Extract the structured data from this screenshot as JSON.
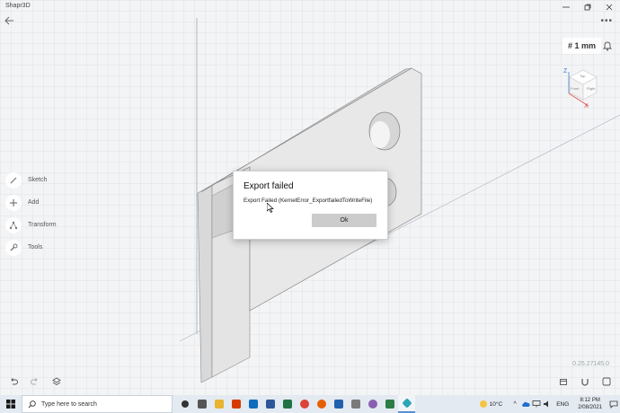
{
  "window": {
    "title": "Shapr3D",
    "controls": [
      "minimize-icon",
      "maximize-icon",
      "close-icon"
    ]
  },
  "toolbar": {
    "more_label": "•••",
    "grid_hash": "#",
    "grid_value": "1 mm"
  },
  "view_cube": {
    "axis_z": "Z",
    "axis_x": "X",
    "face_top": "Top",
    "face_front": "Front",
    "face_right": "Right"
  },
  "tools": [
    {
      "label": "Sketch",
      "icon": "pencil-icon"
    },
    {
      "label": "Add",
      "icon": "plus-icon"
    },
    {
      "label": "Transform",
      "icon": "transform-icon"
    },
    {
      "label": "Tools",
      "icon": "wrench-icon"
    }
  ],
  "version": "0.25.27145.0",
  "dialog": {
    "title": "Export failed",
    "message": "Export Failed (KernelError_ExportfailedToWriteFile)",
    "ok_label": "Ok"
  },
  "taskbar": {
    "search_placeholder": "Type here to search",
    "weather": "10°C",
    "language": "ENG",
    "time": "8:12 PM",
    "date": "2/08/2021",
    "apps": [
      {
        "name": "task-view",
        "color": "#333333"
      },
      {
        "name": "widgets",
        "color": "#555555"
      },
      {
        "name": "file-explorer",
        "color": "#e8b431"
      },
      {
        "name": "office",
        "color": "#d83b01"
      },
      {
        "name": "outlook",
        "color": "#0f6cbd"
      },
      {
        "name": "word",
        "color": "#2b579a"
      },
      {
        "name": "excel",
        "color": "#217346"
      },
      {
        "name": "chrome",
        "color": "#db4437"
      },
      {
        "name": "firefox",
        "color": "#e66000"
      },
      {
        "name": "photos",
        "color": "#1f5fae"
      },
      {
        "name": "app-a",
        "color": "#7a7a7a"
      },
      {
        "name": "app-b",
        "color": "#8a5fb0"
      },
      {
        "name": "app-c",
        "color": "#2d7d46"
      },
      {
        "name": "shapr3d",
        "color": "#2aa6b6",
        "active": true
      }
    ]
  }
}
